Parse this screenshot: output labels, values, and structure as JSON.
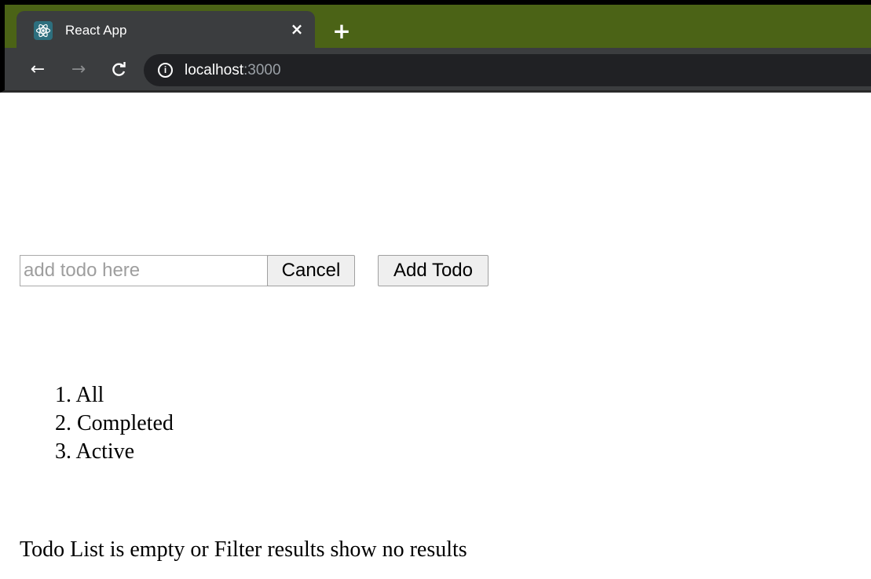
{
  "browser": {
    "tab_title": "React App",
    "tab_close": "×",
    "new_tab": "+",
    "url_host": "localhost",
    "url_port": ":3000",
    "back": "←",
    "forward": "→",
    "reload": "C",
    "info": "i"
  },
  "form": {
    "input_placeholder": "add todo here",
    "input_value": "",
    "cancel_label": "Cancel",
    "add_label": "Add Todo"
  },
  "filters": [
    {
      "num": "1.",
      "label": "All"
    },
    {
      "num": "2.",
      "label": "Completed"
    },
    {
      "num": "3.",
      "label": "Active"
    }
  ],
  "empty_message": "Todo List is empty or Filter results show no results",
  "colors": {
    "tabstrip": "#4b6316",
    "chrome": "#3b3d3f",
    "omnibox": "#202124"
  }
}
